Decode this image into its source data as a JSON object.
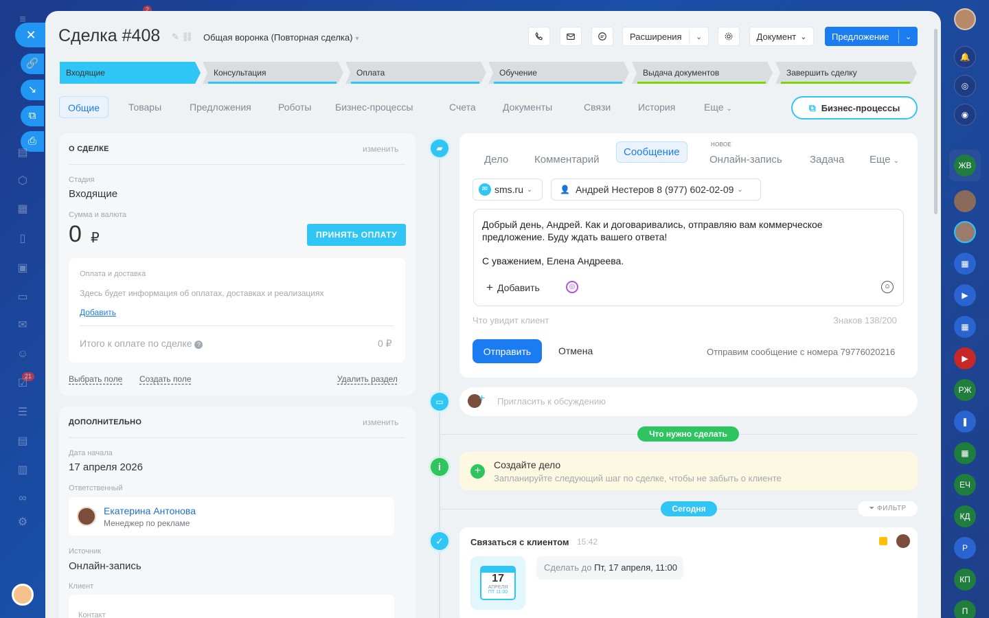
{
  "header": {
    "title": "Сделка #408",
    "funnel": "Общая воронка (Повторная сделка)",
    "extensions_label": "Расширения",
    "document_label": "Документ",
    "offer_label": "Предложение"
  },
  "stages": [
    {
      "label": "Входящие",
      "color": "#2fc6f6"
    },
    {
      "label": "Консультация",
      "color": "#2fc6f6"
    },
    {
      "label": "Оплата",
      "color": "#2fc6f6"
    },
    {
      "label": "Обучение",
      "color": "#2fc6f6"
    },
    {
      "label": "Выдача документов",
      "color": "#7bd500"
    },
    {
      "label": "Завершить сделку",
      "color": "#7bd500"
    }
  ],
  "tabs": [
    "Общие",
    "Товары",
    "Предложения",
    "Роботы",
    "Бизнес-процессы",
    "Счета",
    "Документы",
    "Связи",
    "История",
    "Еще"
  ],
  "bp_button": "Бизнес-процессы",
  "about": {
    "title": "О СДЕЛКЕ",
    "edit": "изменить",
    "stage_label": "Стадия",
    "stage_value": "Входящие",
    "sum_label": "Сумма и валюта",
    "sum_value": "0",
    "currency": "₽",
    "accept_payment": "ПРИНЯТЬ ОПЛАТУ",
    "payment_title": "Оплата и доставка",
    "payment_info": "Здесь будет информация об оплатах, доставках и реализациях",
    "payment_add": "Добавить",
    "total_label": "Итого к оплате по сделке",
    "total_value": "0 ₽",
    "select_field": "Выбрать поле",
    "create_field": "Создать поле",
    "delete_section": "Удалить раздел"
  },
  "extra": {
    "title": "ДОПОЛНИТЕЛЬНО",
    "edit": "изменить",
    "start_label": "Дата начала",
    "start_value": "17 апреля 2026",
    "resp_label": "Ответственный",
    "resp_name": "Екатерина Антонова",
    "resp_role": "Менеджер по рекламе",
    "source_label": "Источник",
    "source_value": "Онлайн-запись",
    "client_label": "Клиент",
    "contact_label": "Контакт"
  },
  "editor": {
    "tabs": [
      "Дело",
      "Комментарий",
      "Сообщение",
      "Онлайн-запись",
      "Задача",
      "Еще"
    ],
    "new_badge": "НОВОЕ",
    "provider": "sms.ru",
    "recipient": "Андрей Нестеров 8 (977) 602-02-09",
    "message_lines": [
      "Добрый день, Андрей. Как и договаривались, отправляю вам коммерческое",
      "предложение. Буду ждать вашего ответа!",
      "",
      "С уважением, Елена Андреева."
    ],
    "add_label": "Добавить",
    "client_sees": "Что увидит клиент",
    "chars": "Знаков 138/200",
    "send": "Отправить",
    "cancel": "Отмена",
    "sender_note": "Отправим сообщение с номера 79776020216"
  },
  "invite_placeholder": "Пригласить к обсуждению",
  "todo_chip": "Что нужно сделать",
  "todo": {
    "title": "Создайте дело",
    "subtitle": "Запланируйте следующий шаг по сделке, чтобы не забыть о клиенте"
  },
  "today_chip": "Сегодня",
  "filter_label": "ФИЛЬТР",
  "task": {
    "title": "Связаться с клиентом",
    "time": "15:42",
    "cal_day": "17",
    "cal_month": "АПРЕЛЯ",
    "cal_time": "ПТ 11:00",
    "deadline_prefix": "Сделать до",
    "deadline": "Пт, 17 апреля, 11:00"
  },
  "right_rail": [
    "ЖВ",
    "РЖ",
    "ЕЧ",
    "КД",
    "Р",
    "КП",
    "П"
  ],
  "left_badges": [
    "2",
    "21"
  ]
}
